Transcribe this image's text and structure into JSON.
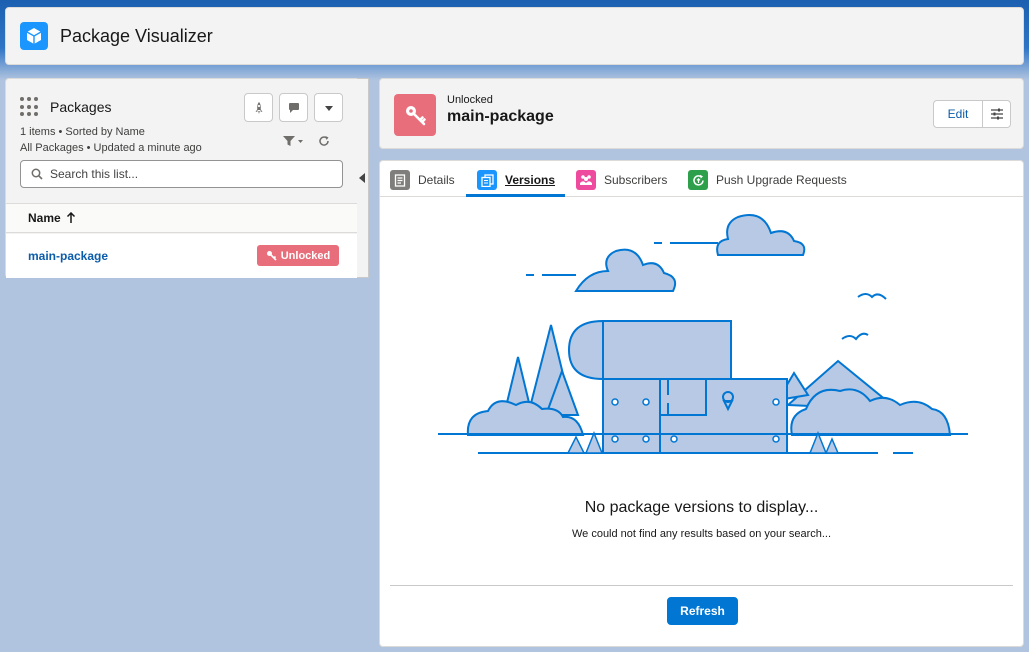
{
  "app": {
    "title": "Package Visualizer",
    "icon": "cube-icon",
    "accent": "#1b96ff"
  },
  "list_panel": {
    "title": "Packages",
    "meta_line1": "1 items • Sorted by Name",
    "meta_line2": "All Packages • Updated a minute ago",
    "search_placeholder": "Search this list...",
    "search_value": "",
    "column_header": "Name",
    "sort_direction_icon": "arrow-up-icon",
    "rows": [
      {
        "name": "main-package",
        "status": "Unlocked",
        "status_icon": "key-icon",
        "status_color": "#e96e7b"
      }
    ]
  },
  "record": {
    "subtitle": "Unlocked",
    "title": "main-package",
    "icon": "key-icon",
    "icon_color": "#e96e7b",
    "edit_label": "Edit"
  },
  "tabs": [
    {
      "label": "Details",
      "icon": "document-icon",
      "active": false
    },
    {
      "label": "Versions",
      "icon": "versions-icon",
      "active": true
    },
    {
      "label": "Subscribers",
      "icon": "people-icon",
      "active": false
    },
    {
      "label": "Push Upgrade Requests",
      "icon": "push-upgrade-icon",
      "active": false
    }
  ],
  "empty_state": {
    "title": "No package versions to display...",
    "subtitle": "We could not find any results based on your search...",
    "refresh_label": "Refresh",
    "illustration": "treasure-chest-illustration"
  },
  "colors": {
    "brand": "#0176d3",
    "link": "#0b5cab",
    "badge": "#e96e7b"
  }
}
